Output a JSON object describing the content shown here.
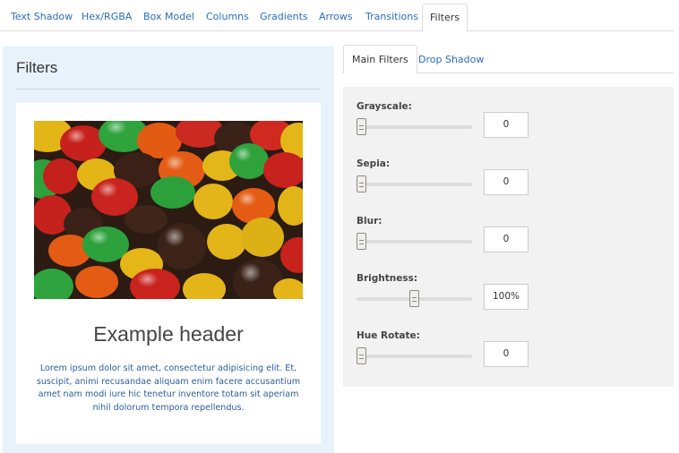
{
  "top_tabs": [
    {
      "label": "Text Shadow"
    },
    {
      "label": "Hex/RGBA"
    },
    {
      "label": "Box Model"
    },
    {
      "label": "Columns"
    },
    {
      "label": "Gradients"
    },
    {
      "label": "Arrows"
    },
    {
      "label": "Transitions"
    },
    {
      "label": "Filters",
      "active": true
    }
  ],
  "left": {
    "title": "Filters",
    "card": {
      "image": "candy-photo",
      "header": "Example header",
      "text": "Lorem ipsum dolor sit amet, consectetur adipisicing elit. Et, suscipit, animi recusandae aliquam enim facere accusantium amet nam modi iure hic tenetur inventore totam sit aperiam nihil dolorum tempora repellendus."
    }
  },
  "sub_tabs": [
    {
      "label": "Main Filters",
      "active": true
    },
    {
      "label": "Drop Shadow"
    }
  ],
  "filters": [
    {
      "label": "Grayscale:",
      "value": "0",
      "level": 0
    },
    {
      "label": "Sepia:",
      "value": "0",
      "level": 0
    },
    {
      "label": "Blur:",
      "value": "0",
      "level": 0
    },
    {
      "label": "Brightness:",
      "value": "100%",
      "level": 0.5
    },
    {
      "label": "Hue Rotate:",
      "value": "0",
      "level": 0
    }
  ],
  "colors": {
    "link": "#2a6ebb",
    "panel": "#e8f2fa",
    "filter_panel": "#f2f2f2"
  }
}
